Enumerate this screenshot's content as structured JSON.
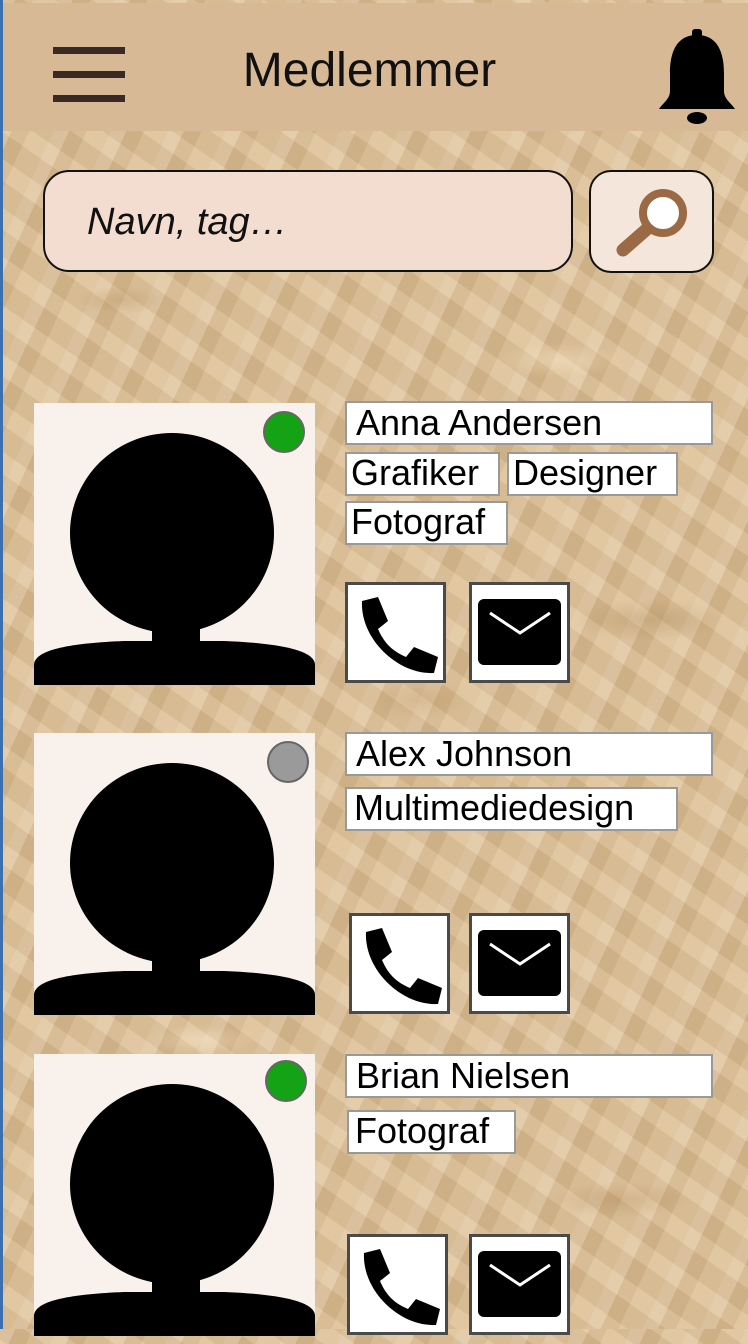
{
  "header": {
    "title": "Medlemmer",
    "menu_icon": "hamburger-menu-icon",
    "notification_icon": "bell-icon"
  },
  "search": {
    "placeholder": "Navn, tag…",
    "button_icon": "magnifier-icon"
  },
  "colors": {
    "online": "#14a314",
    "offline": "#9a9a9a",
    "header_bg": "#d8b995",
    "search_bg": "#f2ddd0"
  },
  "members": [
    {
      "name": "Anna Andersen",
      "status": "online",
      "tags": [
        "Grafiker",
        "Designer",
        "Fotograf"
      ],
      "actions": [
        "phone-icon",
        "mail-icon"
      ]
    },
    {
      "name": "Alex Johnson",
      "status": "offline",
      "tags": [
        "Multimediedesign"
      ],
      "actions": [
        "phone-icon",
        "mail-icon"
      ]
    },
    {
      "name": "Brian Nielsen",
      "status": "online",
      "tags": [
        "Fotograf"
      ],
      "actions": [
        "phone-icon",
        "mail-icon"
      ]
    }
  ]
}
